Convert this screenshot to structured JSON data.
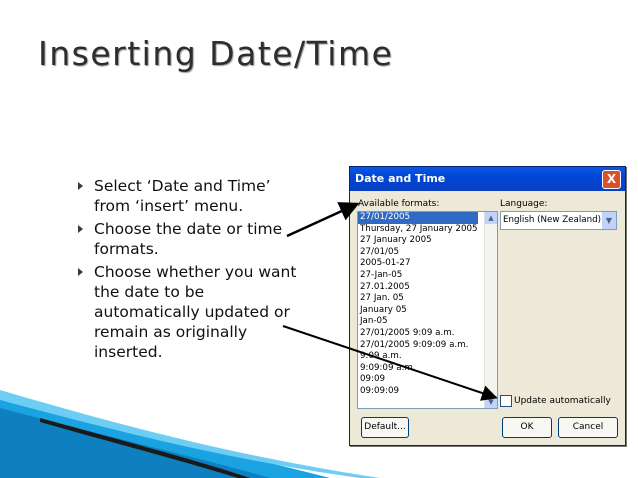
{
  "slide": {
    "title": "Inserting Date/Time",
    "bullets": [
      "Select ‘Date and Time’ from ‘insert’ menu.",
      "Choose the date or time formats.",
      "Choose whether you want the date to be automatically updated or remain as originally inserted."
    ]
  },
  "dialog": {
    "title": "Date and Time",
    "close_label": "X",
    "available_formats_label": "Available formats:",
    "formats": [
      "27/01/2005",
      "Thursday, 27 January 2005",
      "27 January 2005",
      "27/01/05",
      "2005-01-27",
      "27-Jan-05",
      "27.01.2005",
      "27 Jan. 05",
      "January 05",
      "Jan-05",
      "27/01/2005 9:09 a.m.",
      "27/01/2005 9:09:09 a.m.",
      "9:09 a.m.",
      "9:09:09 a.m.",
      "09:09",
      "09:09:09"
    ],
    "selected_format_index": 0,
    "language_label": "Language:",
    "language_value": "English (New Zealand)",
    "update_auto_label": "Update automatically",
    "update_auto_checked": false,
    "default_button": "Default...",
    "ok_button": "OK",
    "cancel_button": "Cancel"
  },
  "colors": {
    "title_bar": "#0a58e6",
    "selection": "#316ac5",
    "dialog_bg": "#ece9d8",
    "decor_blue": "#1aa3e0"
  }
}
